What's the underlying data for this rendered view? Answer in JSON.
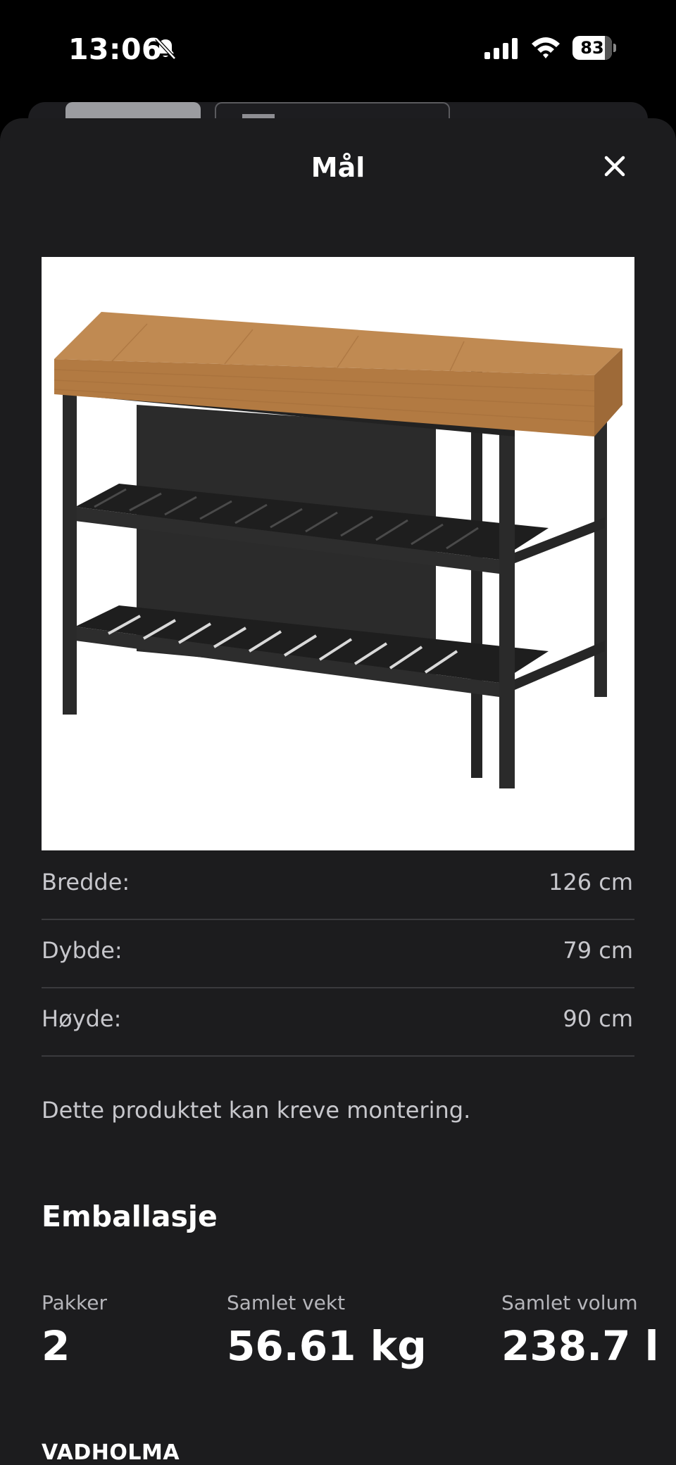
{
  "status_bar": {
    "time": "13:06",
    "battery": "83",
    "battery_level": 0.83
  },
  "sheet": {
    "title": "Mål"
  },
  "dimensions": [
    {
      "label": "Bredde:",
      "value": "126 cm"
    },
    {
      "label": "Dybde:",
      "value": "79 cm"
    },
    {
      "label": "Høyde:",
      "value": "90 cm"
    }
  ],
  "assembly_note": "Dette produktet kan kreve montering.",
  "packaging": {
    "title": "Emballasje",
    "packages_label": "Pakker",
    "packages_value": "2",
    "weight_label": "Samlet vekt",
    "weight_value": "56.61 kg",
    "volume_label": "Samlet volum",
    "volume_value": "238.7 l"
  },
  "product_name": "VADHOLMA",
  "colors": {
    "sheet_background": "#1c1c1e",
    "divider": "#3a3a3d",
    "secondary_text": "#c7c7cc"
  }
}
